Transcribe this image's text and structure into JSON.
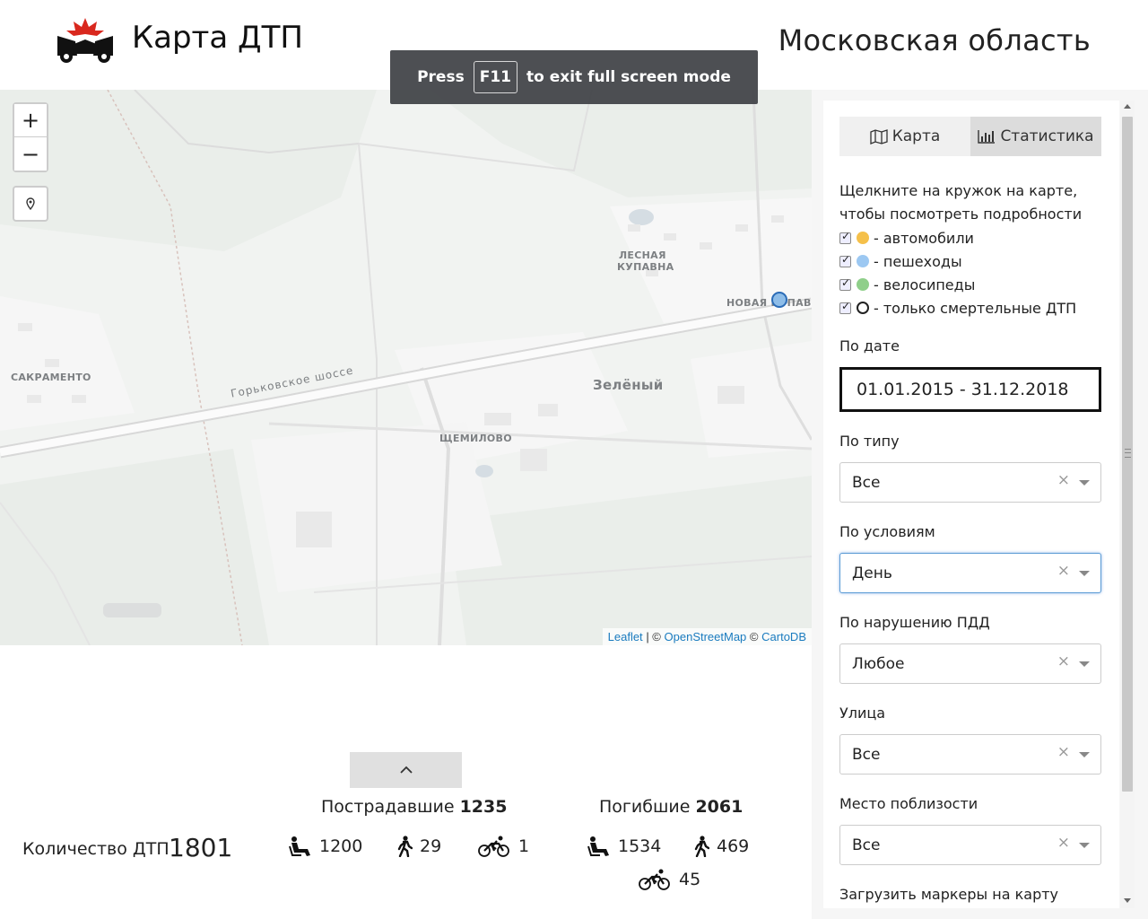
{
  "header": {
    "app_title": "Карта ДТП",
    "region": "Московская область"
  },
  "fullscreen_toast": {
    "press": "Press",
    "key": "F11",
    "message": "to exit full screen mode"
  },
  "map": {
    "zoom_in": "+",
    "zoom_out": "−",
    "labels": {
      "lesnaya_kupavna_1": "ЛЕСНАЯ",
      "lesnaya_kupavna_2": "КУПАВНА",
      "novaya_kupavna": "НОВАЯ КУПАВНА",
      "sakramento": "САКРАМЕНТО",
      "zelenyi": "Зелёный",
      "shchemilovo": "ЩЕМИЛОВО",
      "gorkovskoe": "Горьковское шоссе"
    },
    "attribution": {
      "leaflet": "Leaflet",
      "sep1": "| ©",
      "osm": "OpenStreetMap",
      "sep2": "©",
      "carto": "CartoDB"
    }
  },
  "sidebar": {
    "tabs": [
      {
        "label": "Карта"
      },
      {
        "label": "Статистика"
      }
    ],
    "hint": "Щелкните на кружок на карте, чтобы посмотреть подробности",
    "legend": [
      {
        "label": "- автомобили",
        "color": "#f5c04a"
      },
      {
        "label": "- пешеходы",
        "color": "#9cc8f2"
      },
      {
        "label": "- велосипеды",
        "color": "#8fcf8a"
      },
      {
        "label": "- только смертельные ДТП",
        "color": "#ffffff"
      }
    ],
    "date_label": "По дате",
    "date_value": "01.01.2015 - 31.12.2018",
    "filters": [
      {
        "label": "По типу",
        "value": "Все"
      },
      {
        "label": "По условиям",
        "value": "День"
      },
      {
        "label": "По нарушению ПДД",
        "value": "Любое"
      },
      {
        "label": "Улица",
        "value": "Все"
      },
      {
        "label": "Место поблизости",
        "value": "Все"
      }
    ],
    "load_markers_label": "Загрузить маркеры на карту",
    "clear_symbol": "×"
  },
  "stats": {
    "total_label": "Количество ДТП",
    "total_value": "1801",
    "injured": {
      "title": "Пострадавшие",
      "total": "1235",
      "drivers": "1200",
      "pedestrians": "29",
      "cyclists": "1"
    },
    "killed": {
      "title": "Погибшие",
      "total": "2061",
      "drivers": "1534",
      "pedestrians": "469",
      "cyclists": "45"
    }
  },
  "colors": {
    "accent_red": "#d9281e",
    "marker_blue": "#2b6cb7",
    "link": "#1a7bbf"
  }
}
